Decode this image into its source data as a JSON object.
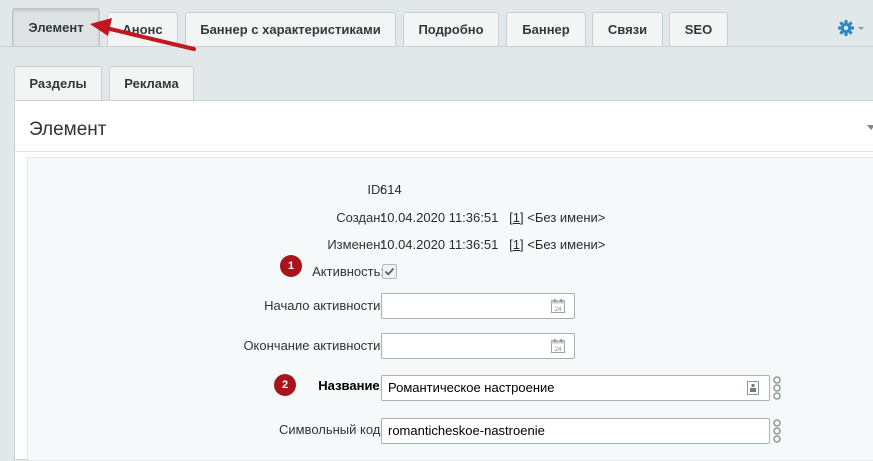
{
  "tabs_row1": [
    {
      "label": "Элемент",
      "active": true
    },
    {
      "label": "Анонс"
    },
    {
      "label": "Баннер с характеристиками"
    },
    {
      "label": "Подробно"
    },
    {
      "label": "Баннер"
    },
    {
      "label": "Связи"
    },
    {
      "label": "SEO"
    }
  ],
  "tabs_row2": [
    {
      "label": "Разделы"
    },
    {
      "label": "Реклама"
    }
  ],
  "settings_icon": "gear-icon",
  "section": {
    "title": "Элемент"
  },
  "form": {
    "id": {
      "label": "ID:",
      "value": "614"
    },
    "created": {
      "label": "Создан:",
      "value": "10.04.2020 11:36:51",
      "user_link": "1",
      "user_name": "<Без имени>"
    },
    "modified": {
      "label": "Изменен:",
      "value": "10.04.2020 11:36:51",
      "user_link": "1",
      "user_name": "<Без имени>"
    },
    "active": {
      "label": "Активность:",
      "checked": true,
      "badge": "1"
    },
    "active_from": {
      "label": "Начало активности:",
      "value": ""
    },
    "active_to": {
      "label": "Окончание активности:",
      "value": ""
    },
    "name": {
      "label": "Название:",
      "value": "Романтическое настроение",
      "badge": "2"
    },
    "code": {
      "label": "Символьный код:",
      "value": "romanticheskoe-nastroenie"
    }
  },
  "colors": {
    "badge": "#a8141c",
    "arrow": "#c3161e",
    "gear": "#2a86c6"
  }
}
